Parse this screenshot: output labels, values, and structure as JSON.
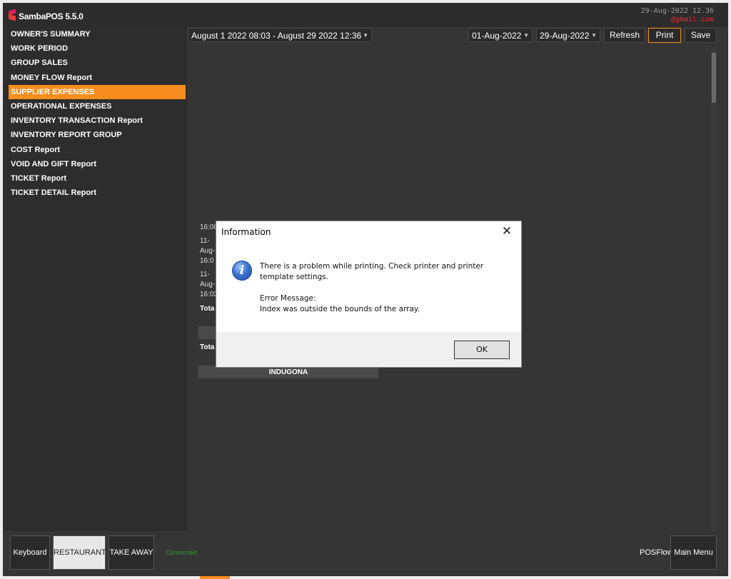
{
  "app": {
    "title": "SambaPOS 5.5.0",
    "datetime": "29-Aug-2022 12.36",
    "email": "@gmail.com"
  },
  "sidebar": {
    "items": [
      {
        "label": "OWNER'S SUMMARY"
      },
      {
        "label": "WORK PERIOD"
      },
      {
        "label": "GROUP SALES"
      },
      {
        "label": "MONEY FLOW Report"
      },
      {
        "label": "SUPPLIER EXPENSES",
        "active": true
      },
      {
        "label": "OPERATIONAL EXPENSES"
      },
      {
        "label": "INVENTORY TRANSACTION Report"
      },
      {
        "label": "INVENTORY REPORT GROUP"
      },
      {
        "label": "COST Report"
      },
      {
        "label": "VOID AND GIFT Report"
      },
      {
        "label": "TICKET Report"
      },
      {
        "label": "TICKET DETAIL Report"
      }
    ]
  },
  "toolbar": {
    "period_select": "August 1 2022 08:03 - August 29 2022 12:36",
    "start_date": "01-Aug-2022",
    "end_date": "29-Aug-2022",
    "refresh_label": "Refresh",
    "print_label": "Print",
    "save_label": "Save"
  },
  "report": {
    "row1_time": "16:00",
    "row2_day": "11-",
    "row2_month": "Aug-",
    "row2_time": "16:0",
    "row3_day": "11-",
    "row3_month": "Aug-",
    "row3_time": "16:03",
    "total_label": "Tota",
    "total2_label": "Tota",
    "band_label": "INDUGONA"
  },
  "dialog": {
    "title": "Information",
    "message": "There is a problem while printing. Check printer and printer template settings.",
    "error_label": "Error Message:",
    "error_text": "Index was outside the bounds of the array.",
    "ok_label": "OK"
  },
  "bottombar": {
    "keyboard_label": "Keyboard",
    "restaurant_label": "RESTAURANT",
    "takeaway_label": "TAKE AWAY",
    "connected_label": "Connected",
    "posflow_label": "POSFlow",
    "main_menu_label": "Main Menu"
  },
  "colors": {
    "accent": "#f68d1e",
    "background": "#353535",
    "sidebar": "#2d2d2d",
    "connected": "#2e9a2e",
    "email": "#e03030"
  }
}
